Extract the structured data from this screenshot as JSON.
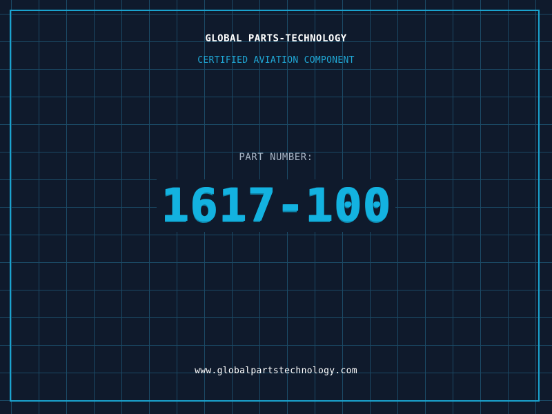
{
  "header": {
    "brand": "GLOBAL PARTS-TECHNOLOGY",
    "tagline": "CERTIFIED AVIATION COMPONENT"
  },
  "part": {
    "label": "PART NUMBER:",
    "number": "1617-100"
  },
  "footer": {
    "website": "www.globalpartstechnology.com"
  },
  "colors": {
    "background": "#0f1a2c",
    "grid": "#1b4a66",
    "accent": "#13b2e0",
    "frame": "#1aa3cf",
    "text": "#ffffff",
    "muted": "#a9b6c6"
  }
}
